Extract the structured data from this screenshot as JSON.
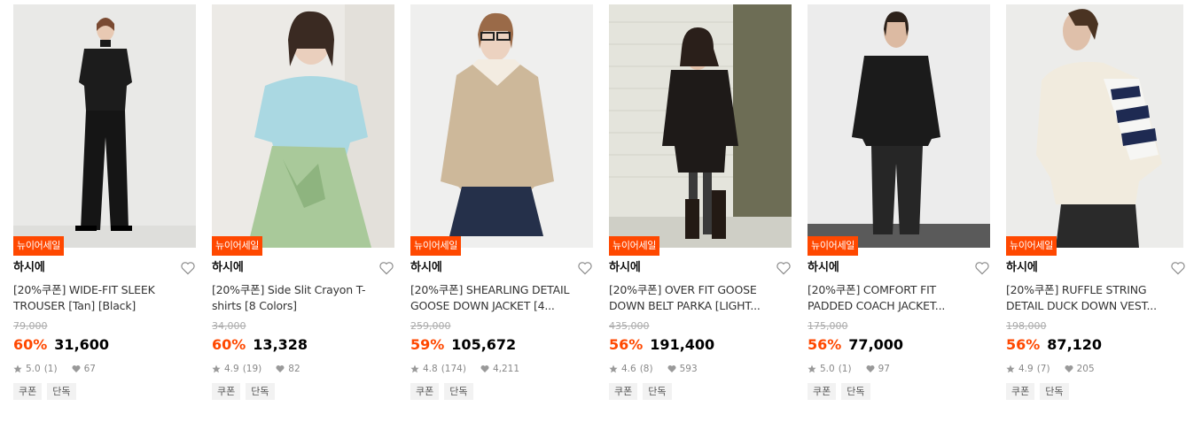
{
  "products": [
    {
      "badge": "뉴이어세일",
      "brand": "하시에",
      "name": "[20%쿠폰] WIDE-FIT SLEEK TROUSER [Tan] [Black]",
      "original_price": "79,000",
      "discount": "60%",
      "price": "31,600",
      "rating": "5.0",
      "reviews": "(1)",
      "likes": "67",
      "tags": [
        "쿠폰",
        "단독"
      ],
      "photo": "woman-black-top-wide-trousers"
    },
    {
      "badge": "뉴이어세일",
      "brand": "하시에",
      "name": "[20%쿠폰] Side Slit Crayon T-shirts [8 Colors]",
      "original_price": "34,000",
      "discount": "60%",
      "price": "13,328",
      "rating": "4.9",
      "reviews": "(19)",
      "likes": "82",
      "tags": [
        "쿠폰",
        "단독"
      ],
      "photo": "woman-light-blue-tshirt-green-skirt"
    },
    {
      "badge": "뉴이어세일",
      "brand": "하시에",
      "name": "[20%쿠폰] SHEARLING DETAIL GOOSE DOWN JACKET [4...",
      "original_price": "259,000",
      "discount": "59%",
      "price": "105,672",
      "rating": "4.8",
      "reviews": "(174)",
      "likes": "4,211",
      "tags": [
        "쿠폰",
        "단독"
      ],
      "photo": "woman-beige-quilted-jacket"
    },
    {
      "badge": "뉴이어세일",
      "brand": "하시에",
      "name": "[20%쿠폰] OVER FIT GOOSE DOWN BELT PARKA [LIGHT...",
      "original_price": "435,000",
      "discount": "56%",
      "price": "191,400",
      "rating": "4.6",
      "reviews": "(8)",
      "likes": "593",
      "tags": [
        "쿠폰",
        "단독"
      ],
      "photo": "woman-black-parka-brick-wall"
    },
    {
      "badge": "뉴이어세일",
      "brand": "하시에",
      "name": "[20%쿠폰] COMFORT FIT PADDED COACH JACKET...",
      "original_price": "175,000",
      "discount": "56%",
      "price": "77,000",
      "rating": "5.0",
      "reviews": "(1)",
      "likes": "97",
      "tags": [
        "쿠폰",
        "단독"
      ],
      "photo": "woman-black-padded-coach-jacket"
    },
    {
      "badge": "뉴이어세일",
      "brand": "하시에",
      "name": "[20%쿠폰] RUFFLE STRING DETAIL DUCK DOWN VEST...",
      "original_price": "198,000",
      "discount": "56%",
      "price": "87,120",
      "rating": "4.9",
      "reviews": "(7)",
      "likes": "205",
      "tags": [
        "쿠폰",
        "단독"
      ],
      "photo": "woman-ivory-down-vest-striped-sleeve"
    }
  ],
  "colors": {
    "accent": "#ff4800",
    "badge_text": "#ffffff",
    "tag_bg": "#f2f2f2"
  },
  "icons": {
    "wishlist": "heart-outline-icon",
    "rating": "star-icon",
    "likes": "heart-filled-icon"
  }
}
